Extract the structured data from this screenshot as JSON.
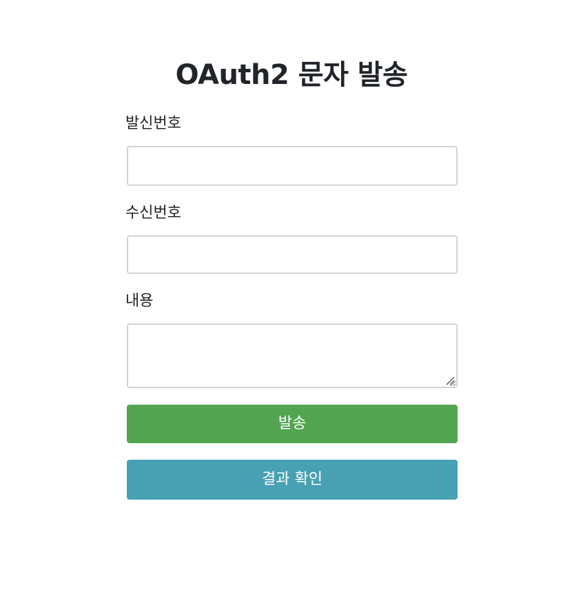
{
  "page": {
    "title": "OAuth2 문자 발송"
  },
  "form": {
    "sender": {
      "label": "발신번호",
      "value": "",
      "placeholder": ""
    },
    "receiver": {
      "label": "수신번호",
      "value": "",
      "placeholder": ""
    },
    "content": {
      "label": "내용",
      "value": "",
      "placeholder": ""
    }
  },
  "buttons": {
    "send_label": "발송",
    "result_label": "결과 확인"
  },
  "colors": {
    "send_button": "#53a451",
    "result_button": "#48a0b3",
    "input_border": "#d3d3d3",
    "text": "#212529"
  }
}
